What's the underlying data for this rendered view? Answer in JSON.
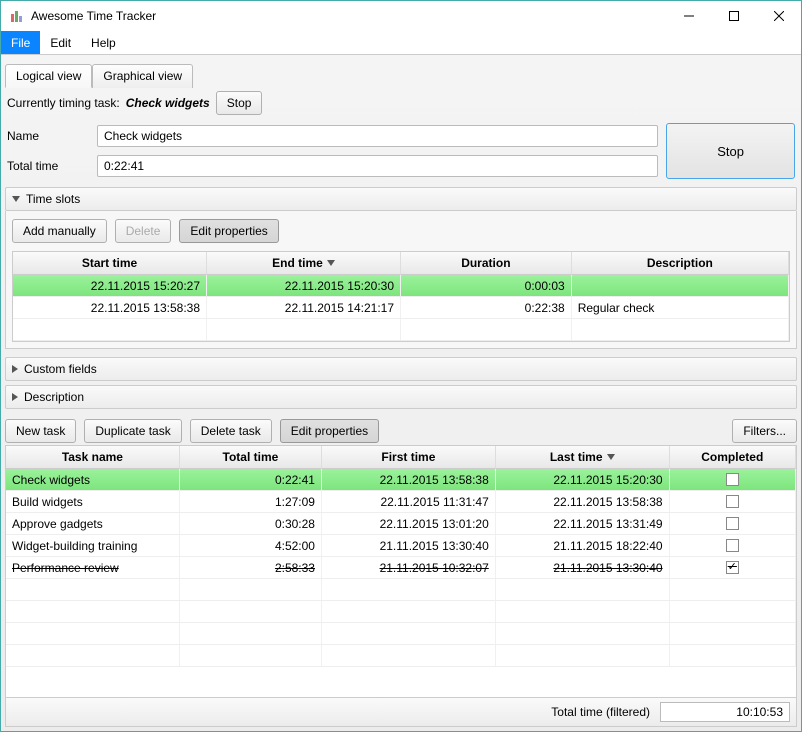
{
  "window": {
    "title": "Awesome Time Tracker"
  },
  "menubar": {
    "file": "File",
    "edit": "Edit",
    "help": "Help"
  },
  "tabs": {
    "logical": "Logical view",
    "graphical": "Graphical view"
  },
  "timing": {
    "label": "Currently timing task:",
    "task": "Check widgets",
    "stop_button": "Stop",
    "big_stop": "Stop"
  },
  "fields": {
    "name_label": "Name",
    "name_value": "Check widgets",
    "totaltime_label": "Total time",
    "totaltime_value": "0:22:41"
  },
  "expanders": {
    "timeslots": "Time slots",
    "customfields": "Custom fields",
    "description": "Description"
  },
  "slots_toolbar": {
    "add": "Add manually",
    "delete": "Delete",
    "edit": "Edit properties"
  },
  "slots_headers": {
    "start": "Start time",
    "end": "End time",
    "duration": "Duration",
    "description": "Description"
  },
  "slots": [
    {
      "start": "22.11.2015 15:20:27",
      "end": "22.11.2015 15:20:30",
      "duration": "0:00:03",
      "description": ""
    },
    {
      "start": "22.11.2015 13:58:38",
      "end": "22.11.2015 14:21:17",
      "duration": "0:22:38",
      "description": "Regular check"
    }
  ],
  "tasks_toolbar": {
    "newtask": "New task",
    "duplicate": "Duplicate task",
    "delete": "Delete task",
    "edit": "Edit properties",
    "filters": "Filters..."
  },
  "tasks_headers": {
    "name": "Task name",
    "total": "Total time",
    "first": "First time",
    "last": "Last time",
    "completed": "Completed"
  },
  "tasks": [
    {
      "name": "Check widgets",
      "total": "0:22:41",
      "first": "22.11.2015 13:58:38",
      "last": "22.11.2015 15:20:30",
      "completed": false,
      "selected": true,
      "striked": false
    },
    {
      "name": "Build widgets",
      "total": "1:27:09",
      "first": "22.11.2015 11:31:47",
      "last": "22.11.2015 13:58:38",
      "completed": false,
      "selected": false,
      "striked": false
    },
    {
      "name": "Approve gadgets",
      "total": "0:30:28",
      "first": "22.11.2015 13:01:20",
      "last": "22.11.2015 13:31:49",
      "completed": false,
      "selected": false,
      "striked": false
    },
    {
      "name": "Widget-building training",
      "total": "4:52:00",
      "first": "21.11.2015 13:30:40",
      "last": "21.11.2015 18:22:40",
      "completed": false,
      "selected": false,
      "striked": false
    },
    {
      "name": "Performance review",
      "total": "2:58:33",
      "first": "21.11.2015 10:32:07",
      "last": "21.11.2015 13:30:40",
      "completed": true,
      "selected": false,
      "striked": true
    }
  ],
  "totals": {
    "label": "Total time (filtered)",
    "value": "10:10:53"
  }
}
